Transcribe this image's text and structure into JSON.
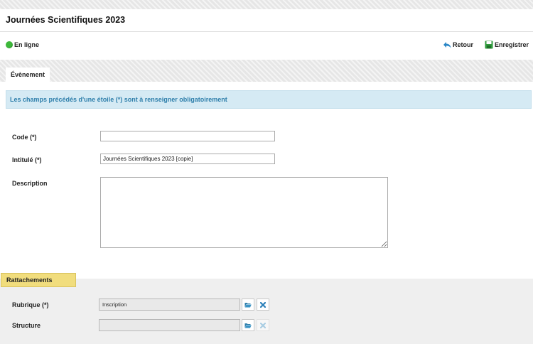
{
  "page": {
    "title": "Journées Scientifiques 2023",
    "status": "En ligne",
    "colors": {
      "online": "#3db83a",
      "info_text": "#2f7fab",
      "info_bg": "#d5eaf4",
      "section_head": "#f1dd7d"
    }
  },
  "actions": {
    "back_label": "Retour",
    "save_label": "Enregistrer",
    "back_icon": "arrow-back-icon",
    "save_icon": "floppy-disk-icon"
  },
  "tabs": [
    {
      "label": "Évènement",
      "active": true
    }
  ],
  "info": {
    "message": "Les champs précédés d'une étoile (*) sont à renseigner obligatoirement"
  },
  "form": {
    "code": {
      "label": "Code (*)",
      "value": ""
    },
    "intitule": {
      "label": "Intitulé (*)",
      "value": "Journées Scientifiques 2023 [copie]"
    },
    "description": {
      "label": "Description",
      "value": ""
    }
  },
  "attachments": {
    "title": "Rattachements",
    "rubrique": {
      "label": "Rubrique (*)",
      "value": "Inscription"
    },
    "structure": {
      "label": "Structure",
      "value": ""
    },
    "icons": {
      "browse": "folder-open-icon",
      "clear": "close-icon"
    }
  }
}
